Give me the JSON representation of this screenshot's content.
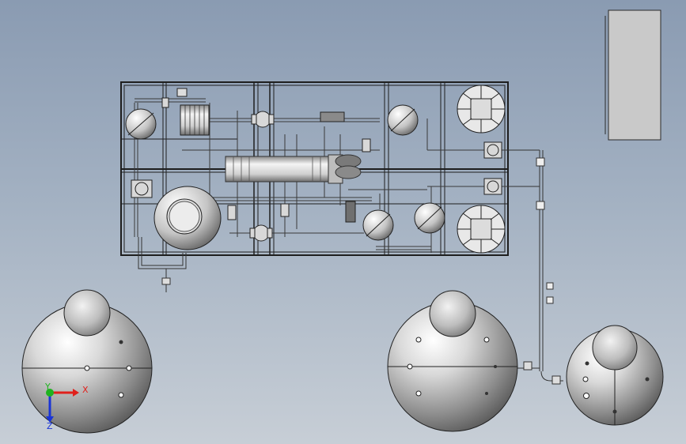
{
  "viewport": {
    "background_top": "#8a9bb2",
    "background_bottom": "#c7ced6"
  },
  "triad": {
    "x_label": "X",
    "y_label": "Y",
    "z_label": "Z",
    "x_color": "#e0201b",
    "y_color": "#1fb31f",
    "z_color": "#1a34d6"
  },
  "colors": {
    "frame_line": "#1e1e1e",
    "metal_light": "#f4f4f4",
    "metal_mid": "#b8b8b8",
    "metal_dark": "#6e6e6e",
    "side_panel": "#c9c9c9",
    "accent_blue": "#1a34d6"
  },
  "icons": [
    "coordinate-triad-icon"
  ]
}
